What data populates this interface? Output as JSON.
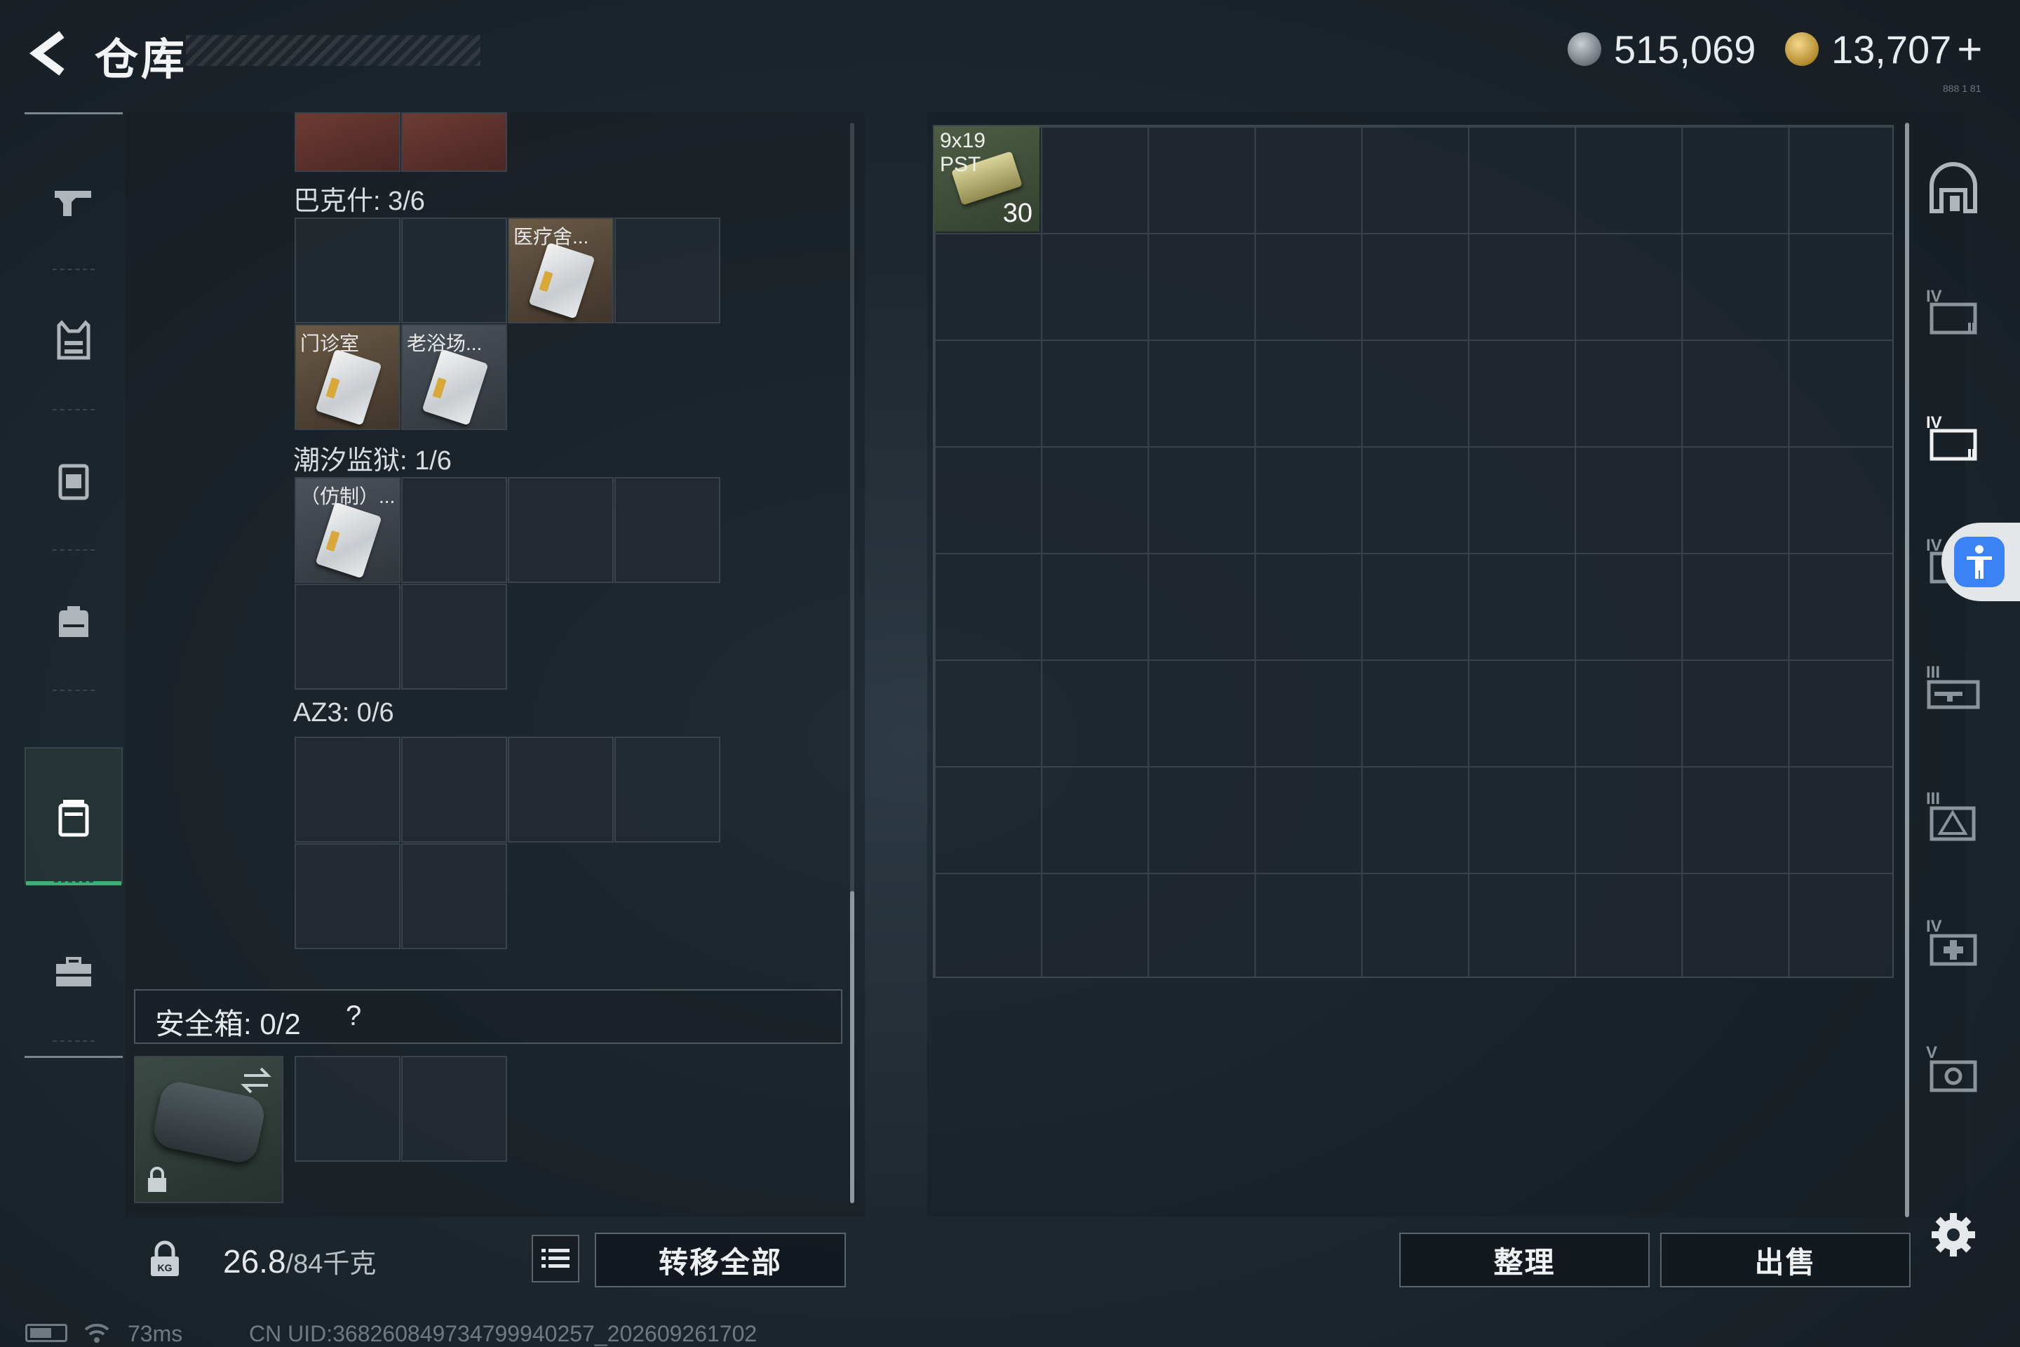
{
  "header": {
    "title": "仓库",
    "currency_silver": "515,069",
    "currency_gold": "13,707",
    "add_symbol": "+",
    "version_hint": "888 1 81"
  },
  "sidebar": {
    "items": [
      {
        "name": "weapons",
        "icon": "pistol-icon"
      },
      {
        "name": "armor",
        "icon": "vest-icon"
      },
      {
        "name": "chest-rig",
        "icon": "rig-icon"
      },
      {
        "name": "backpack",
        "icon": "backpack-icon"
      },
      {
        "name": "container",
        "icon": "case-icon",
        "active": true
      },
      {
        "name": "tools",
        "icon": "toolbox-icon"
      }
    ]
  },
  "left_panel": {
    "groups": [
      {
        "label": "巴克什: 3/6"
      },
      {
        "label": "潮汐监狱: 1/6",
        "items": [
          "医疗舍...",
          "门诊室",
          "老浴场..."
        ]
      },
      {
        "label": "AZ3: 0/6",
        "items": [
          "（仿制）..."
        ]
      }
    ],
    "safe_box": {
      "label": "安全箱: 0/2",
      "help": "?"
    },
    "weight": {
      "value": "26.8",
      "max": "/84千克"
    },
    "transfer_all": "转移全部"
  },
  "stash": {
    "item": {
      "name_line1": "9x19",
      "name_line2": "PST",
      "count": "30"
    },
    "sort_label": "整理",
    "sell_label": "出售",
    "category_icons": [
      "stash-home-icon",
      "key-case-iv-icon",
      "key-case-iv-icon",
      "key-case-iv-icon",
      "weapon-case-iii-icon",
      "ammo-case-iii-icon",
      "medical-case-iv-icon",
      "cassette-case-v-icon"
    ]
  },
  "status_bar": {
    "ping": "73ms",
    "uid": "CN UID:368260849734799940257_202609261702"
  },
  "colors": {
    "accent_green": "#3fae77",
    "access_blue": "#3b82f6"
  }
}
